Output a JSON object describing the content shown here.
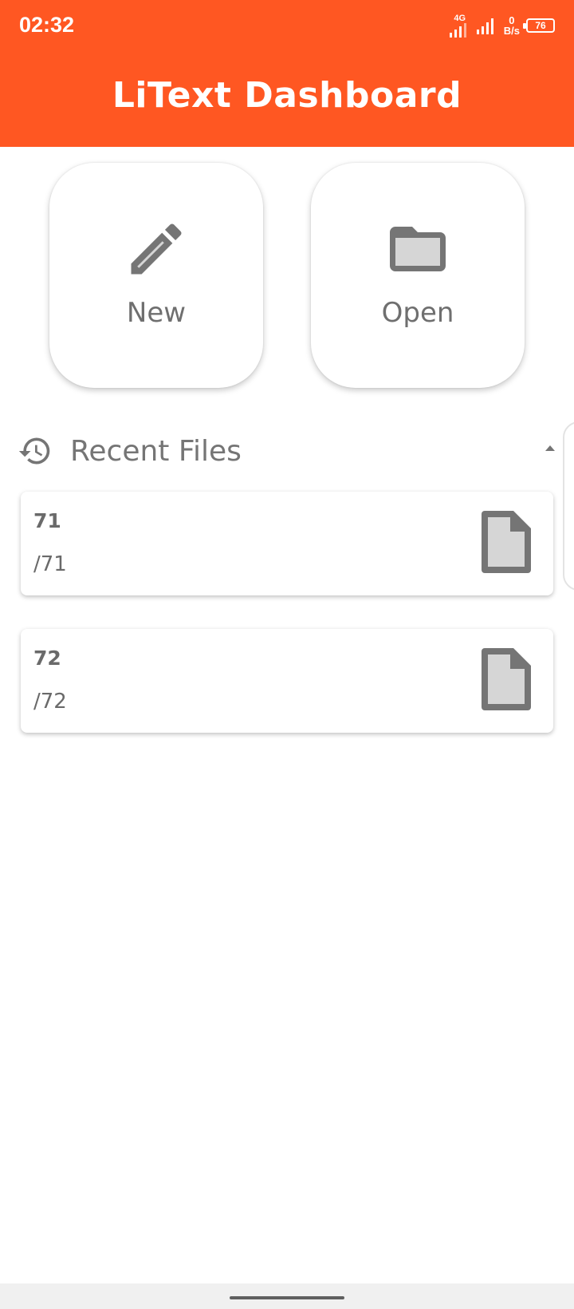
{
  "status_bar": {
    "time": "02:32",
    "network": "4G",
    "speed_value": "0",
    "speed_unit": "B/s",
    "battery": "76"
  },
  "header": {
    "title": "LiText Dashboard"
  },
  "actions": {
    "new_label": "New",
    "open_label": "Open"
  },
  "recent": {
    "title": "Recent Files",
    "files": [
      {
        "name": "71",
        "path": "/71"
      },
      {
        "name": "72",
        "path": "/72"
      }
    ]
  },
  "colors": {
    "accent": "#ff5722",
    "icon_gray": "#757575",
    "icon_fill": "#d6d6d6"
  }
}
